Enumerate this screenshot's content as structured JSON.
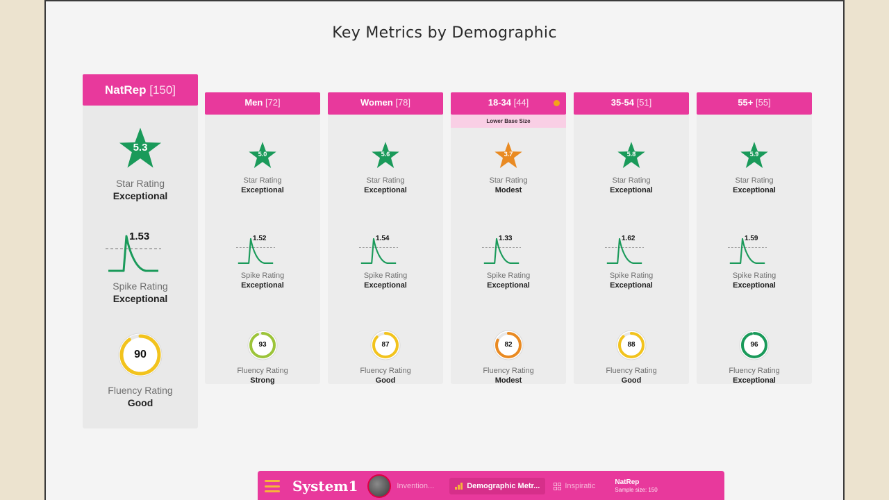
{
  "title": "Key Metrics by Demographic",
  "colors": {
    "brand_pink": "#e8399c",
    "excellent_green": "#1a9a5a",
    "modest_orange": "#e98a22",
    "ring_yellow": "#f2c31d",
    "ring_track": "#e7e7e7"
  },
  "columns": [
    {
      "id": "natrep",
      "name": "NatRep",
      "n": "[150]",
      "lower_base": "",
      "star": {
        "value": "5.3",
        "label": "Star Rating",
        "rating": "Exceptional",
        "color": "#1a9a5a"
      },
      "spike": {
        "value": "1.53",
        "label": "Spike Rating",
        "rating": "Exceptional"
      },
      "fluency": {
        "value": "90",
        "label": "Fluency Rating",
        "rating": "Good",
        "ring_color": "#f2c31d"
      }
    },
    {
      "id": "men",
      "name": "Men",
      "n": "[72]",
      "lower_base": "",
      "star": {
        "value": "5.0",
        "label": "Star Rating",
        "rating": "Exceptional",
        "color": "#1a9a5a"
      },
      "spike": {
        "value": "1.52",
        "label": "Spike Rating",
        "rating": "Exceptional"
      },
      "fluency": {
        "value": "93",
        "label": "Fluency Rating",
        "rating": "Strong",
        "ring_color": "#9cc43a"
      }
    },
    {
      "id": "women",
      "name": "Women",
      "n": "[78]",
      "lower_base": "",
      "star": {
        "value": "5.6",
        "label": "Star Rating",
        "rating": "Exceptional",
        "color": "#1a9a5a"
      },
      "spike": {
        "value": "1.54",
        "label": "Spike Rating",
        "rating": "Exceptional"
      },
      "fluency": {
        "value": "87",
        "label": "Fluency Rating",
        "rating": "Good",
        "ring_color": "#f2c31d"
      }
    },
    {
      "id": "18-34",
      "name": "18-34",
      "n": "[44]",
      "lower_base": "Lower Base Size",
      "star": {
        "value": "3.7",
        "label": "Star Rating",
        "rating": "Modest",
        "color": "#e98a22"
      },
      "spike": {
        "value": "1.33",
        "label": "Spike Rating",
        "rating": "Exceptional"
      },
      "fluency": {
        "value": "82",
        "label": "Fluency Rating",
        "rating": "Modest",
        "ring_color": "#e98a22"
      }
    },
    {
      "id": "35-54",
      "name": "35-54",
      "n": "[51]",
      "lower_base": "",
      "star": {
        "value": "5.8",
        "label": "Star Rating",
        "rating": "Exceptional",
        "color": "#1a9a5a"
      },
      "spike": {
        "value": "1.62",
        "label": "Spike Rating",
        "rating": "Exceptional"
      },
      "fluency": {
        "value": "88",
        "label": "Fluency Rating",
        "rating": "Good",
        "ring_color": "#f2c31d"
      }
    },
    {
      "id": "55+",
      "name": "55+",
      "n": "[55]",
      "lower_base": "",
      "star": {
        "value": "5.9",
        "label": "Star Rating",
        "rating": "Exceptional",
        "color": "#1a9a5a"
      },
      "spike": {
        "value": "1.59",
        "label": "Spike Rating",
        "rating": "Exceptional"
      },
      "fluency": {
        "value": "96",
        "label": "Fluency Rating",
        "rating": "Exceptional",
        "ring_color": "#1a9a5a"
      }
    }
  ],
  "bottombar": {
    "brand": "System1",
    "item_1": "Invention...",
    "active_item": "Demographic Metr...",
    "item_3": "Inspiratic",
    "sample_title": "NatRep",
    "sample_size": "Sample size: 150",
    "icons": [
      "menu-icon",
      "bar-chart-icon",
      "grid-icon"
    ]
  }
}
